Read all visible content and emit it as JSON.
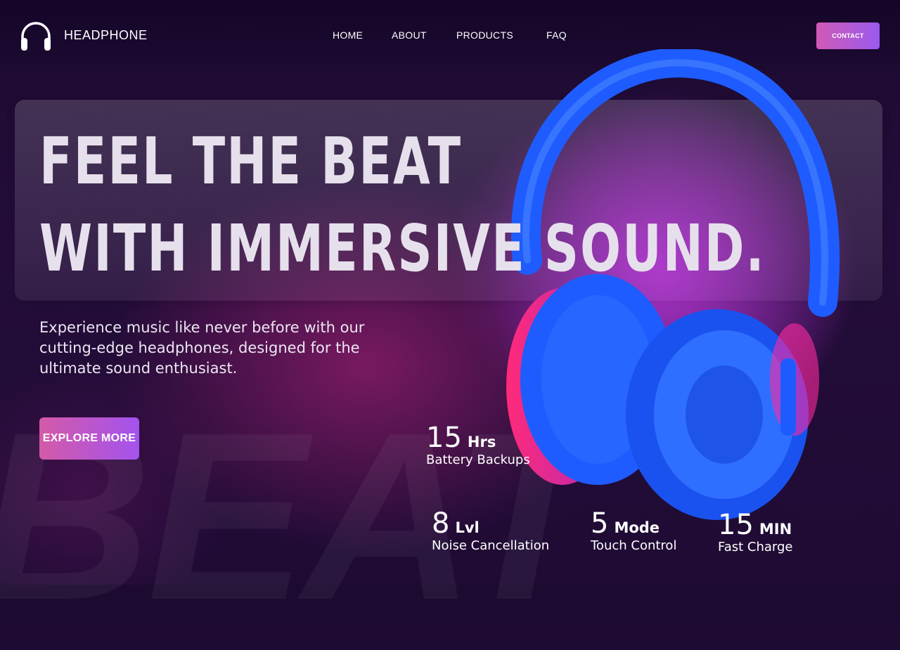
{
  "brand": {
    "name": "HEADPHONE",
    "logo_icon": "headphone-icon"
  },
  "nav": {
    "items": [
      "HOME",
      "ABOUT",
      "PRODUCTS",
      "FAQ"
    ]
  },
  "contact_label": "CONTACT",
  "hero": {
    "line1": "FEEL THE BEAT",
    "line2": "WITH IMMERSIVE SOUND.",
    "subtitle": "Experience music like never before with our cutting-edge headphones, designed for the ultimate sound enthusiast.",
    "cta": "EXPLORE MORE",
    "watermark": "BEAT"
  },
  "stats": [
    {
      "value": "15",
      "unit": "Hrs",
      "label": "Battery Backups"
    },
    {
      "value": "8",
      "unit": "Lvl",
      "label": "Noise Cancellation"
    },
    {
      "value": "5",
      "unit": "Mode",
      "label": "Touch Control"
    },
    {
      "value": "15",
      "unit": "MIN",
      "label": "Fast Charge"
    }
  ],
  "colors": {
    "background": "#1f0b34",
    "accent_start": "#d45aa8",
    "accent_end": "#a353ee",
    "headphone_blue": "#1e5bff",
    "headphone_pink": "#ff2a7a"
  }
}
